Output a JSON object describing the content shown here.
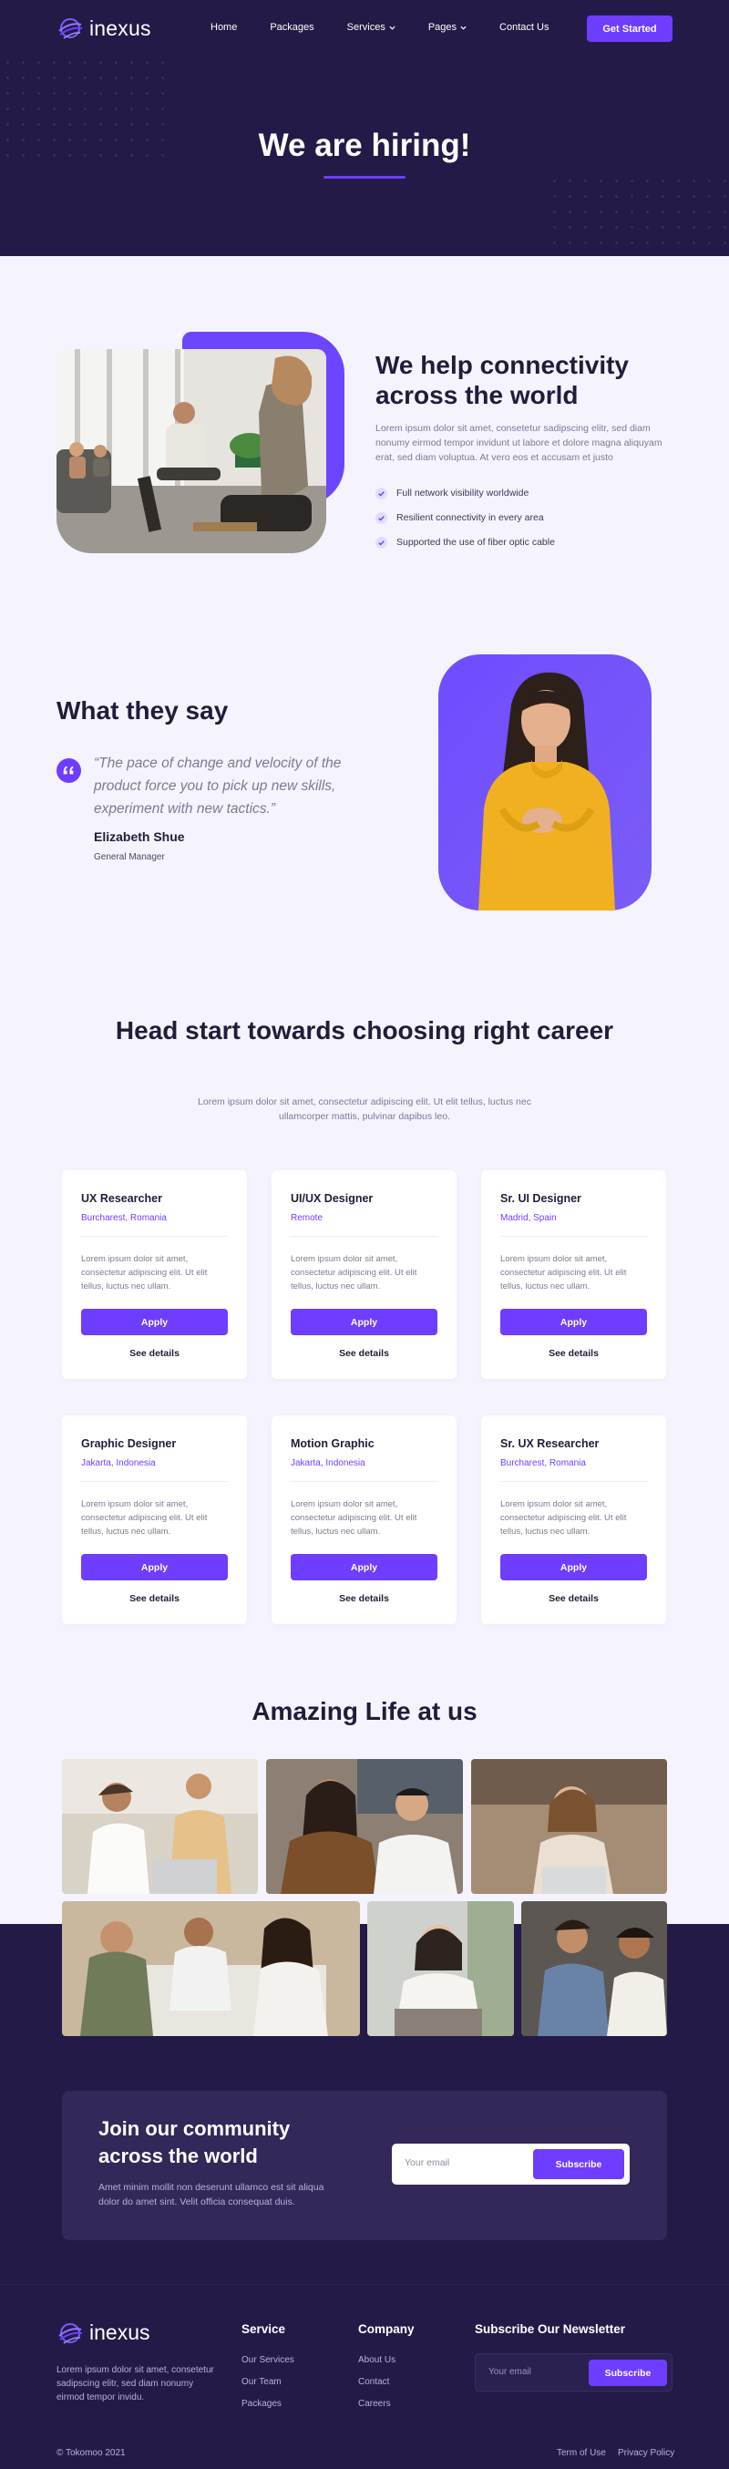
{
  "brand": {
    "name": "inexus"
  },
  "nav": {
    "items": [
      {
        "label": "Home",
        "dropdown": false
      },
      {
        "label": "Packages",
        "dropdown": false
      },
      {
        "label": "Services",
        "dropdown": true
      },
      {
        "label": "Pages",
        "dropdown": true
      },
      {
        "label": "Contact Us",
        "dropdown": false
      }
    ],
    "cta": "Get Started"
  },
  "hero": {
    "title": "We are hiring!"
  },
  "connect": {
    "title": "We help connectivity across the world",
    "body": "Lorem ipsum dolor sit amet, consetetur sadipscing elitr, sed diam nonumy eirmod tempor invidunt ut labore et dolore magna aliquyam erat, sed diam voluptua. At vero eos et accusam et justo",
    "features": [
      "Full network visibility worldwide",
      "Resilient connectivity in every area",
      "Supported the use of fiber optic cable"
    ]
  },
  "testimonial": {
    "title": "What they say",
    "quote": "“The pace of change and velocity of the product force you to pick up new skills, experiment with new tactics.”",
    "name": "Elizabeth Shue",
    "role": "General Manager"
  },
  "careers": {
    "title": "Head start towards choosing right career",
    "subtitle": "Lorem ipsum dolor sit amet, consectetur adipiscing elit. Ut elit tellus, luctus nec ullamcorper mattis, pulvinar dapibus leo.",
    "apply_label": "Apply",
    "details_label": "See details",
    "jobs": [
      {
        "title": "UX Researcher",
        "location": "Burcharest, Romania",
        "desc": "Lorem ipsum dolor sit amet, consectetur adipiscing elit. Ut elit tellus, luctus nec ullam."
      },
      {
        "title": "UI/UX Designer",
        "location": "Remote",
        "desc": "Lorem ipsum dolor sit amet, consectetur adipiscing elit. Ut elit tellus, luctus nec ullam."
      },
      {
        "title": "Sr. UI Designer",
        "location": "Madrid, Spain",
        "desc": "Lorem ipsum dolor sit amet, consectetur adipiscing elit. Ut elit tellus, luctus nec ullam."
      },
      {
        "title": "Graphic Designer",
        "location": "Jakarta, Indonesia",
        "desc": "Lorem ipsum dolor sit amet, consectetur adipiscing elit. Ut elit tellus, luctus nec ullam."
      },
      {
        "title": "Motion Graphic",
        "location": "Jakarta, Indonesia",
        "desc": "Lorem ipsum dolor sit amet, consectetur adipiscing elit. Ut elit tellus, luctus nec ullam."
      },
      {
        "title": "Sr. UX Researcher",
        "location": "Burcharest, Romania",
        "desc": "Lorem ipsum dolor sit amet, consectetur adipiscing elit. Ut elit tellus, luctus nec ullam."
      }
    ]
  },
  "life": {
    "title": "Amazing Life at us"
  },
  "community": {
    "title": "Join our community across the world",
    "body": "Amet minim mollit non deserunt ullamco est sit aliqua dolor do amet sint. Velit officia consequat duis.",
    "email_placeholder": "Your email",
    "subscribe": "Subscribe"
  },
  "footer": {
    "description": "Lorem ipsum dolor sit amet, consetetur sadipscing elitr, sed diam nonumy eirmod tempor invidu.",
    "service": {
      "title": "Service",
      "links": [
        "Our Services",
        "Our Team",
        "Packages"
      ]
    },
    "company": {
      "title": "Company",
      "links": [
        "About Us",
        "Contact",
        "Careers"
      ]
    },
    "newsletter": {
      "title": "Subscribe Our Newsletter",
      "email_placeholder": "Your email",
      "subscribe": "Subscribe"
    },
    "copyright": "© Tokomoo 2021",
    "legal": [
      "Term of Use",
      "Privacy Policy"
    ]
  },
  "colors": {
    "primary": "#6f3dff",
    "dark": "#241a47",
    "background": "#f5f3fe",
    "text": "#1f1d3a",
    "muted": "#7c7a92"
  }
}
